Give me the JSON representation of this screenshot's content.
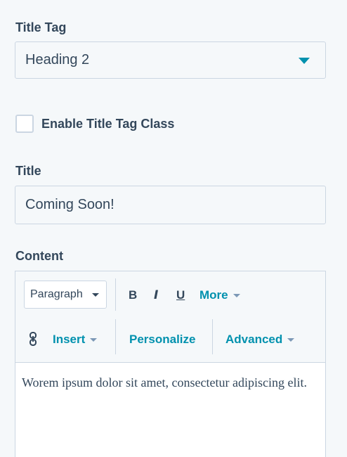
{
  "title_tag": {
    "label": "Title Tag",
    "value": "Heading 2"
  },
  "enable_class": {
    "label": "Enable Title Tag Class",
    "checked": false
  },
  "title": {
    "label": "Title",
    "value": "Coming Soon!"
  },
  "content": {
    "label": "Content",
    "toolbar": {
      "block_format": "Paragraph",
      "bold": "B",
      "italic": "I",
      "underline": "U",
      "more": "More",
      "insert": "Insert",
      "personalize": "Personalize",
      "advanced": "Advanced"
    },
    "text": "Worem ipsum dolor sit amet, consectetur adipiscing elit."
  },
  "colors": {
    "accent": "#0091ae",
    "text": "#33475b",
    "border": "#cbd6e2",
    "background": "#f5f8fa"
  },
  "icons": {
    "dropdown": "caret-down-icon",
    "link": "link-icon"
  }
}
